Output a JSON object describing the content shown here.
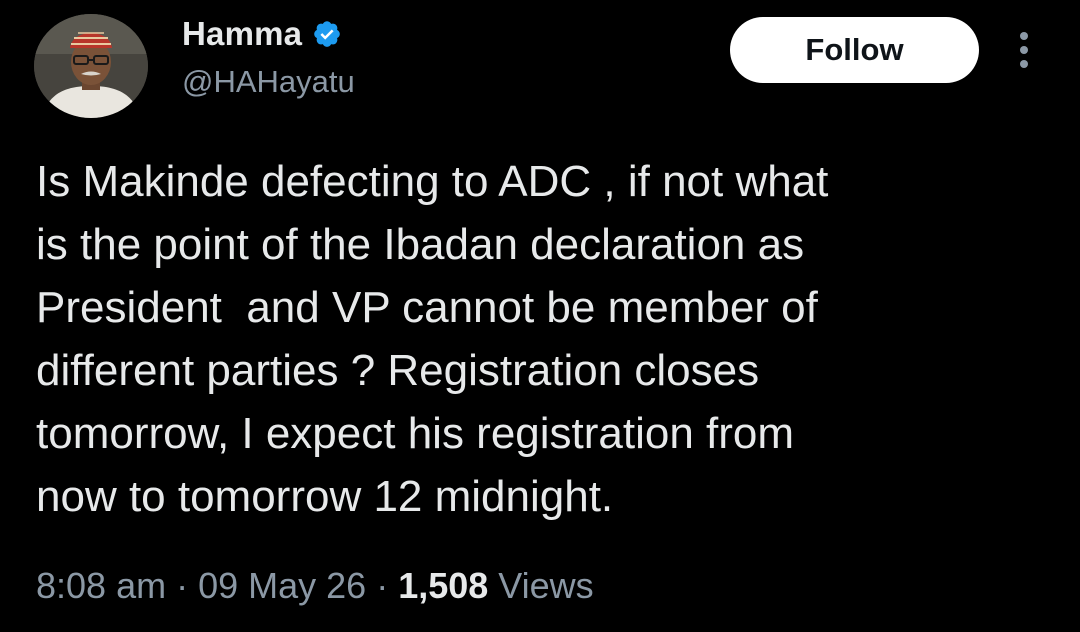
{
  "tweet": {
    "author": {
      "display_name": "Hamma",
      "handle": "@HAHayatu",
      "verified": true,
      "avatar_icon": "profile-photo"
    },
    "follow_label": "Follow",
    "more_icon": "more-vertical-icon",
    "text": "Is Makinde defecting to ADC , if not what\nis the point of the Ibadan declaration as\nPresident  and VP cannot be member of\ndifferent parties ? Registration closes\ntomorrow, I expect his registration from\nnow to tomorrow 12 midnight.",
    "time": "8:08 am",
    "separator": " · ",
    "date": "09 May 26",
    "views_count": "1,508",
    "views_label": " Views"
  },
  "colors": {
    "background": "#000000",
    "text_primary": "#e7e9ea",
    "text_secondary": "#8b98a5",
    "verified_badge": "#1d9bf0",
    "follow_bg": "#ffffff",
    "follow_text": "#0f1419"
  }
}
